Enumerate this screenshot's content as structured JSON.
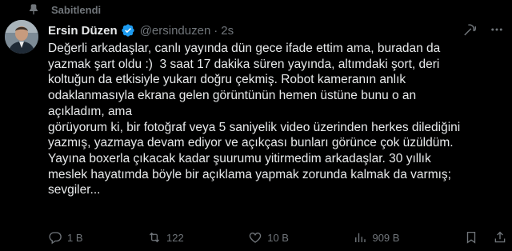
{
  "pinned_label": "Sabitlendi",
  "author": {
    "name": "Ersin Düzen",
    "handle": "@ersinduzen",
    "time": "2s"
  },
  "tweet_text": "Değerli arkadaşlar, canlı yayında dün gece ifade ettim ama, buradan da\nyazmak şart oldu :)  3 saat 17 dakika süren yayında, altımdaki şort, deri\nkoltuğun da etkisiyle yukarı doğru çekmiş. Robot kameranın anlık\nodaklanmasıyla ekrana gelen görüntünün hemen üstüne bunu o an\naçıkladım, ama\ngörüyorum ki, bir fotoğraf veya 5 saniyelik video üzerinden herkes dilediğini\nyazmış, yazmaya devam ediyor ve açıkçası bunları görünce çok üzüldüm.\nYayına boxerla çıkacak kadar şuurumu yitirmedim arkadaşlar. 30 yıllık\nmeslek hayatımda böyle bir açıklama yapmak zorunda kalmak da varmış;\nsevgiler...",
  "metrics": {
    "replies": "1 B",
    "retweets": "122",
    "likes": "10 B",
    "views": "909 B"
  },
  "icons": {
    "pin": "pin-icon",
    "verified": "verified-badge-icon",
    "grok": "grok-icon",
    "more": "more-icon",
    "reply": "reply-icon",
    "retweet": "retweet-icon",
    "like": "like-icon",
    "views": "views-icon",
    "bookmark": "bookmark-icon",
    "share": "share-icon"
  },
  "colors": {
    "background": "#000000",
    "text": "#e7e9ea",
    "muted": "#71767b",
    "verified": "#1d9bf0"
  }
}
